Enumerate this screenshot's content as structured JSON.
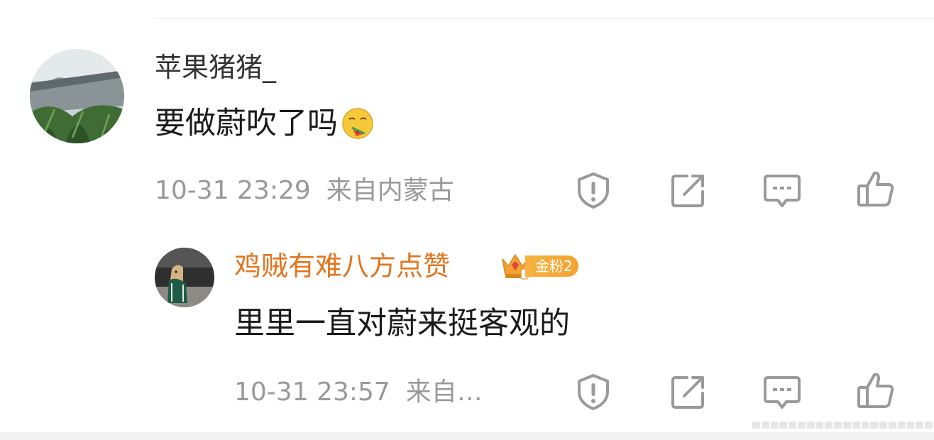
{
  "comment": {
    "author": "苹果猪猪_",
    "text": "要做蔚吹了吗",
    "emoji_icon": "drooling-watermelon-emoji-icon",
    "time": "10-31 23:29",
    "location": "来自内蒙古"
  },
  "reply": {
    "author": "鸡贼有难八方点赞",
    "badge": "金粉2",
    "text": "里里一直对蔚来挺客观的",
    "time": "10-31 23:57",
    "location": "来自…"
  },
  "actions": [
    "report-icon",
    "share-icon",
    "comment-icon",
    "like-icon"
  ],
  "colors": {
    "author_reply": "#e3741c",
    "meta": "#999999",
    "icon": "#9a9a9a",
    "badge": "#f3a233"
  }
}
